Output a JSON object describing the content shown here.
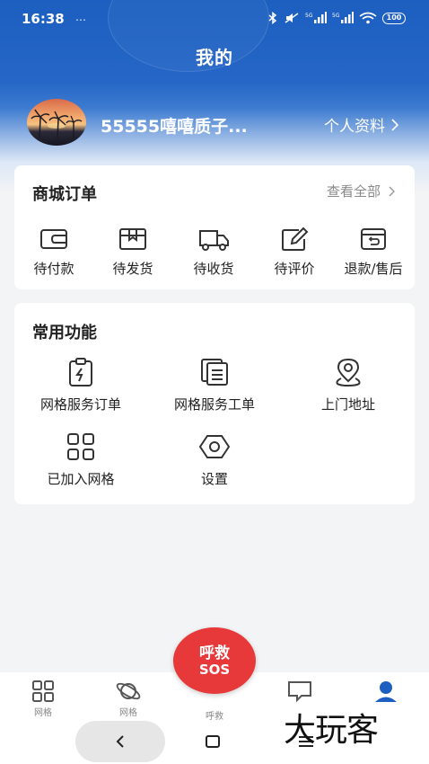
{
  "status_bar": {
    "time": "16:38",
    "extra": "…",
    "battery": "100"
  },
  "header": {
    "title": "我的"
  },
  "profile": {
    "username": "55555嘻嘻质子...",
    "link_label": "个人资料"
  },
  "orders": {
    "title": "商城订单",
    "view_all": "查看全部",
    "items": [
      {
        "label": "待付款",
        "icon": "wallet-icon"
      },
      {
        "label": "待发货",
        "icon": "box-icon"
      },
      {
        "label": "待收货",
        "icon": "truck-icon"
      },
      {
        "label": "待评价",
        "icon": "edit-icon"
      },
      {
        "label": "退款/售后",
        "icon": "refund-icon"
      }
    ]
  },
  "functions": {
    "title": "常用功能",
    "items": [
      {
        "label": "网格服务订单",
        "icon": "clipboard-icon"
      },
      {
        "label": "网格服务工单",
        "icon": "documents-icon"
      },
      {
        "label": "上门地址",
        "icon": "location-icon"
      },
      {
        "label": "已加入网格",
        "icon": "grid-icon"
      },
      {
        "label": "设置",
        "icon": "settings-icon"
      }
    ]
  },
  "bottom_nav": {
    "items": [
      {
        "label": "网格",
        "icon": "grid-icon"
      },
      {
        "label": "网格",
        "icon": "planet-icon"
      },
      {
        "label": "呼救",
        "icon": "sos-icon"
      },
      {
        "label": "",
        "icon": "message-icon"
      },
      {
        "label": "",
        "icon": "person-icon",
        "active": true
      }
    ],
    "sos_line1": "呼救",
    "sos_line2": "SOS"
  },
  "watermark": "大玩客",
  "colors": {
    "brand_blue": "#1c5fc0",
    "sos_red": "#e8393a",
    "nav_active": "#1c5fc0"
  }
}
